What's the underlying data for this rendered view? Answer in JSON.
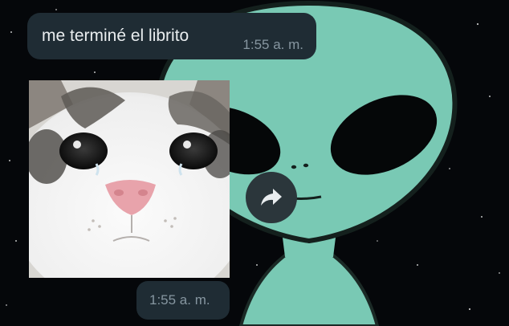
{
  "chat": {
    "messages": [
      {
        "type": "text",
        "text": "me terminé el librito",
        "time": "1:55 a. m."
      },
      {
        "type": "image",
        "image_subject": "crying white cat close-up",
        "time": "1:55 a. m."
      }
    ],
    "forward_icon": "forward-arrow-icon"
  },
  "wallpaper": {
    "subject": "teal alien face on starry black background"
  },
  "colors": {
    "bubble": "#1f2c34",
    "message_text": "#e9edef",
    "timestamp": "#8696a0",
    "wallpaper_alien": "#79c9b4",
    "wallpaper_bg": "#05070a",
    "forward_button": "#2b363b"
  }
}
